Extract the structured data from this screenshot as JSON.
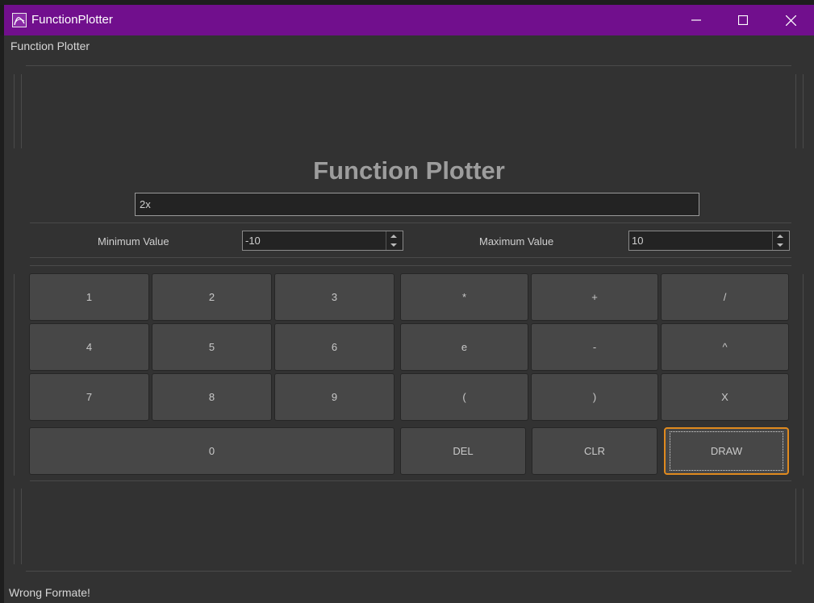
{
  "window": {
    "title": "FunctionPlotter",
    "menu_label": "Function Plotter",
    "controls": [
      "minimize",
      "maximize",
      "close"
    ]
  },
  "main": {
    "heading": "Function Plotter",
    "function_input": {
      "value": "2x"
    },
    "min": {
      "label": "Minimum Value",
      "value": "-10"
    },
    "max": {
      "label": "Maximum Value",
      "value": "10"
    }
  },
  "keypad": {
    "digits": [
      "1",
      "2",
      "3",
      "4",
      "5",
      "6",
      "7",
      "8",
      "9",
      "0"
    ],
    "operators": [
      "*",
      "+",
      "/",
      "e",
      "-",
      "^",
      "(",
      ")",
      "X"
    ],
    "del": "DEL",
    "clr": "CLR",
    "draw": "DRAW"
  },
  "status_text": "Wrong Formate!",
  "colors": {
    "titlebar": "#710f8d",
    "focus_border": "#e08a1e",
    "button": "#474747",
    "window_bg": "#323232"
  }
}
